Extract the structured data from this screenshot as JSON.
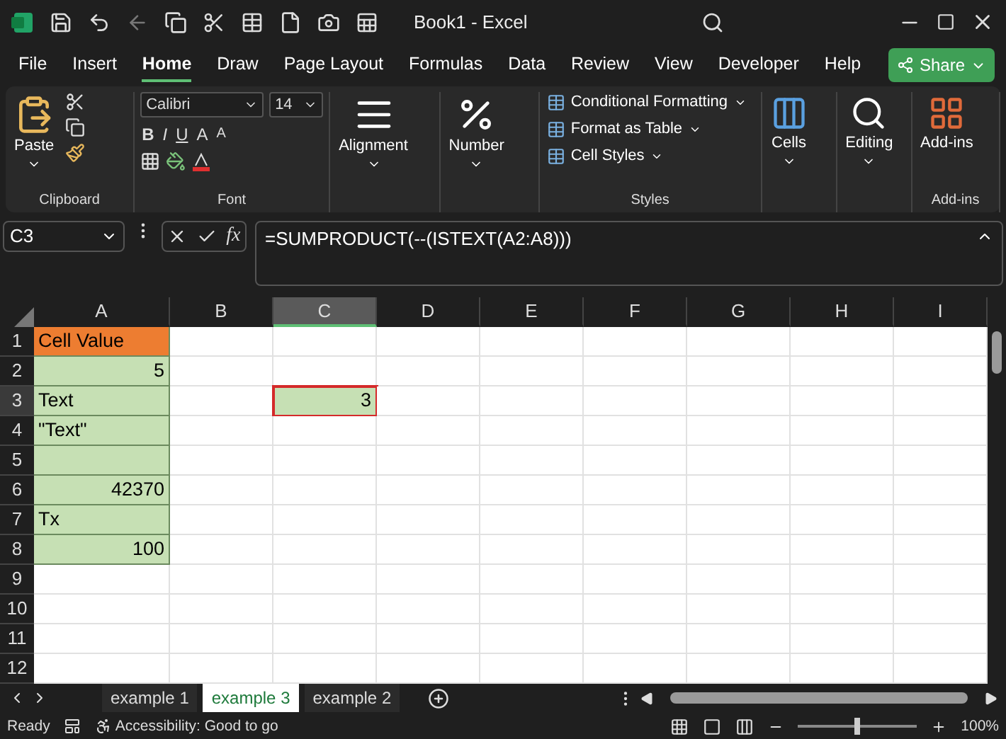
{
  "title_bar": {
    "title": "Book1  -  Excel"
  },
  "menu_tabs": [
    {
      "label": "File",
      "selected": false
    },
    {
      "label": "Insert",
      "selected": false
    },
    {
      "label": "Home",
      "selected": true
    },
    {
      "label": "Draw",
      "selected": false
    },
    {
      "label": "Page Layout",
      "selected": false
    },
    {
      "label": "Formulas",
      "selected": false
    },
    {
      "label": "Data",
      "selected": false
    },
    {
      "label": "Review",
      "selected": false
    },
    {
      "label": "View",
      "selected": false
    },
    {
      "label": "Developer",
      "selected": false
    },
    {
      "label": "Help",
      "selected": false
    }
  ],
  "share_button": {
    "label": "Share"
  },
  "ribbon": {
    "paste": "Paste",
    "font_name": "Calibri",
    "font_size": "14",
    "font_buttons": [
      "B",
      "I",
      "U",
      "A",
      "A"
    ],
    "alignment": "Alignment",
    "number": "Number",
    "styles": [
      "Conditional Formatting",
      "Format as Table",
      "Cell Styles"
    ],
    "cells": "Cells",
    "editing": "Editing",
    "addins": "Add-ins",
    "group_labels": {
      "clipboard": "Clipboard",
      "font": "Font",
      "styles": "Styles",
      "addins": "Add-ins"
    }
  },
  "formula_bar": {
    "name_box": "C3",
    "fx": "fx",
    "formula": "=SUMPRODUCT(--(ISTEXT(A2:A8)))"
  },
  "columns": [
    {
      "label": "A",
      "selected": false
    },
    {
      "label": "B",
      "selected": false
    },
    {
      "label": "C",
      "selected": true
    },
    {
      "label": "D",
      "selected": false
    },
    {
      "label": "E",
      "selected": false
    },
    {
      "label": "F",
      "selected": false
    },
    {
      "label": "G",
      "selected": false
    },
    {
      "label": "H",
      "selected": false
    },
    {
      "label": "I",
      "selected": false
    }
  ],
  "rows": [
    {
      "number": "1",
      "cells": [
        {
          "value": "Cell Value",
          "kind": "text",
          "color": "#ed7d31",
          "selected": false
        }
      ]
    },
    {
      "number": "2",
      "cells": [
        {
          "value": "5",
          "kind": "number",
          "color": "#c6e0b4",
          "selected": false
        }
      ]
    },
    {
      "number": "3",
      "cells": [
        {
          "value": "Text",
          "kind": "text",
          "color": "#c6e0b4",
          "selected": false
        },
        {
          "selected": false
        },
        {
          "value": "3",
          "kind": "number",
          "color": "#c6e0b4",
          "selected": true
        }
      ]
    },
    {
      "number": "4",
      "cells": [
        {
          "value": "\"Text\"",
          "kind": "text",
          "color": "#c6e0b4",
          "selected": false
        }
      ]
    },
    {
      "number": "5",
      "cells": [
        {
          "color": "#c6e0b4",
          "selected": false
        }
      ]
    },
    {
      "number": "6",
      "cells": [
        {
          "value": "42370",
          "kind": "number",
          "color": "#c6e0b4",
          "selected": false
        }
      ]
    },
    {
      "number": "7",
      "cells": [
        {
          "value": "Tx",
          "kind": "text",
          "color": "#c6e0b4",
          "selected": false
        }
      ]
    },
    {
      "number": "8",
      "cells": [
        {
          "value": "100",
          "kind": "number",
          "color": "#c6e0b4",
          "selected": false
        }
      ]
    },
    {
      "number": "9",
      "cells": []
    },
    {
      "number": "10",
      "cells": []
    },
    {
      "number": "11",
      "cells": []
    },
    {
      "number": "12",
      "cells": []
    }
  ],
  "sheet_tabs": [
    {
      "label": "example 1",
      "selected": false
    },
    {
      "label": "example 3",
      "selected": true
    },
    {
      "label": "example 2",
      "selected": false
    }
  ],
  "status_bar": {
    "ready": "Ready",
    "accessibility": "Accessibility: Good to go",
    "zoom": "100%",
    "zoom_slider": {
      "level": 0.5
    }
  }
}
